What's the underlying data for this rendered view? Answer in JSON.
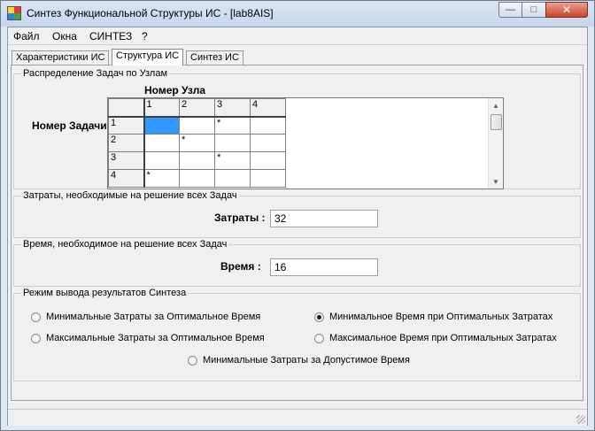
{
  "window": {
    "title": "Синтез Функциональной Структуры ИС - [lab8AIS]"
  },
  "menu": [
    "Файл",
    "Окна",
    "СИНТЕЗ",
    "?"
  ],
  "tabs": [
    {
      "label": "Характеристики ИС",
      "active": false
    },
    {
      "label": "Структура ИС",
      "active": true
    },
    {
      "label": "Синтез ИС",
      "active": false
    }
  ],
  "distribution": {
    "legend": "Распределение Задач по Узлам",
    "col_header_label": "Номер Узла",
    "row_header_label": "Номер Задачи",
    "columns": [
      "1",
      "2",
      "3",
      "4"
    ],
    "rows": [
      {
        "label": "1",
        "cells": [
          "",
          "",
          "*",
          ""
        ],
        "selected_col": 0
      },
      {
        "label": "2",
        "cells": [
          "",
          "*",
          "",
          ""
        ]
      },
      {
        "label": "3",
        "cells": [
          "",
          "",
          "*",
          ""
        ]
      },
      {
        "label": "4",
        "cells": [
          "*",
          "",
          "",
          ""
        ]
      }
    ]
  },
  "costs": {
    "legend": "Затраты, необходимые на решение всех Задач",
    "label": "Затраты :",
    "value": "32"
  },
  "time": {
    "legend": "Время, необходимое на решение всех Задач",
    "label": "Время :",
    "value": "16"
  },
  "mode": {
    "legend": "Режим вывода результатов Синтеза",
    "options": [
      {
        "label": "Минимальные Затраты за Оптимальное Время",
        "checked": false
      },
      {
        "label": "Минимальное Время при Оптимальных Затратах",
        "checked": true
      },
      {
        "label": "Максимальные Затраты за Оптимальное Время",
        "checked": false
      },
      {
        "label": "Максимальное Время при Оптимальных Затратах",
        "checked": false
      },
      {
        "label": "Минимальные Затраты за Допустимое  Время",
        "checked": false
      }
    ]
  },
  "icons": {
    "minimize": "minimize-icon",
    "maximize": "maximize-icon",
    "close": "close-icon",
    "app": "app-icon"
  }
}
